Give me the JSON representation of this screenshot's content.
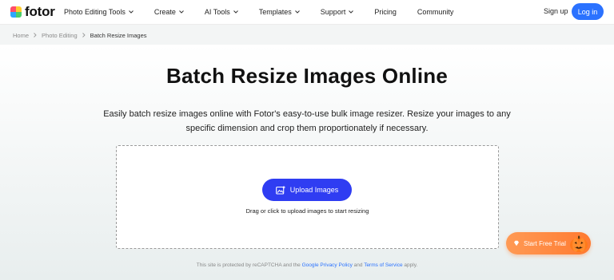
{
  "header": {
    "brand": "fotor",
    "nav": [
      {
        "label": "Photo Editing Tools",
        "has_dropdown": true
      },
      {
        "label": "Create",
        "has_dropdown": true
      },
      {
        "label": "AI Tools",
        "has_dropdown": true
      },
      {
        "label": "Templates",
        "has_dropdown": true
      },
      {
        "label": "Support",
        "has_dropdown": true
      },
      {
        "label": "Pricing",
        "has_dropdown": false
      },
      {
        "label": "Community",
        "has_dropdown": false
      }
    ],
    "signup_label": "Sign up",
    "login_label": "Log in"
  },
  "breadcrumb": {
    "items": [
      "Home",
      "Photo Editing",
      "Batch Resize Images"
    ]
  },
  "main": {
    "title": "Batch Resize Images Online",
    "description": "Easily batch resize images online with Fotor's easy-to-use bulk image resizer. Resize your images to any specific dimension and crop them proportionately if necessary.",
    "upload_button_label": "Upload Images",
    "drop_hint": "Drag or click to upload images to start resizing"
  },
  "footer": {
    "prefix": "This site is protected by reCAPTCHA and the ",
    "privacy_link": "Google Privacy Policy",
    "middle": " and ",
    "terms_link": "Terms of Service",
    "suffix": " apply."
  },
  "floating_cta": {
    "label": "Start Free Trial",
    "icon": "diamond-icon",
    "decoration": "pumpkin-icon"
  },
  "colors": {
    "accent_blue": "#2b72ff",
    "upload_button": "#2f3df2",
    "trial_orange": "#ff8a40"
  }
}
